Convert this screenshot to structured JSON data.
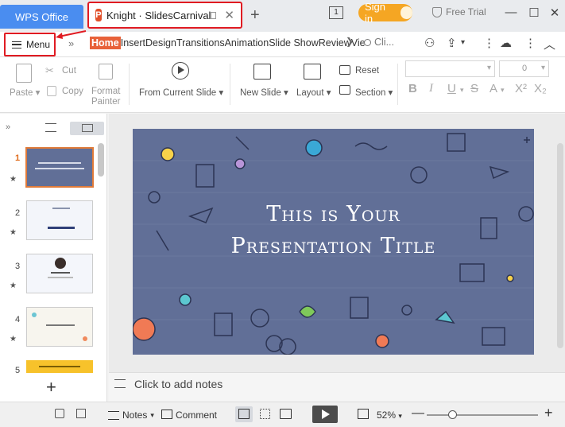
{
  "titlebar": {
    "home_tab": "WPS Office",
    "doc_tab": "Knight · SlidesCarnival",
    "window_count": "1",
    "sign_in": "Sign in",
    "free_trial": "Free Trial"
  },
  "menubar": {
    "menu_label": "Menu",
    "tabs": [
      "Home",
      "Insert",
      "Design",
      "Transitions",
      "Animation",
      "Slide Show",
      "Review",
      "Vie"
    ],
    "search": "Cli..."
  },
  "toolbar": {
    "paste": "Paste",
    "cut": "Cut",
    "copy": "Copy",
    "format_painter_1": "Format",
    "format_painter_2": "Painter",
    "from_current_slide": "From Current Slide",
    "new_slide": "New Slide",
    "layout": "Layout",
    "reset": "Reset",
    "section": "Section",
    "font_size": "0"
  },
  "thumbnails": [
    {
      "num": "1",
      "active": true
    },
    {
      "num": "2",
      "active": false
    },
    {
      "num": "3",
      "active": false
    },
    {
      "num": "4",
      "active": false
    },
    {
      "num": "5",
      "active": false
    }
  ],
  "slide": {
    "title_line1": "This is Your",
    "title_line2": "Presentation Title",
    "bg_color": "#616f97"
  },
  "notes": {
    "placeholder": "Click to add notes"
  },
  "statusbar": {
    "notes": "Notes",
    "comment": "Comment",
    "zoom": "52%"
  },
  "colors": {
    "accent_red": "#e01b22",
    "home_tab_blue": "#4a8df0",
    "sign_in_orange": "#f5a623",
    "active_ribbon": "#e8623a"
  }
}
